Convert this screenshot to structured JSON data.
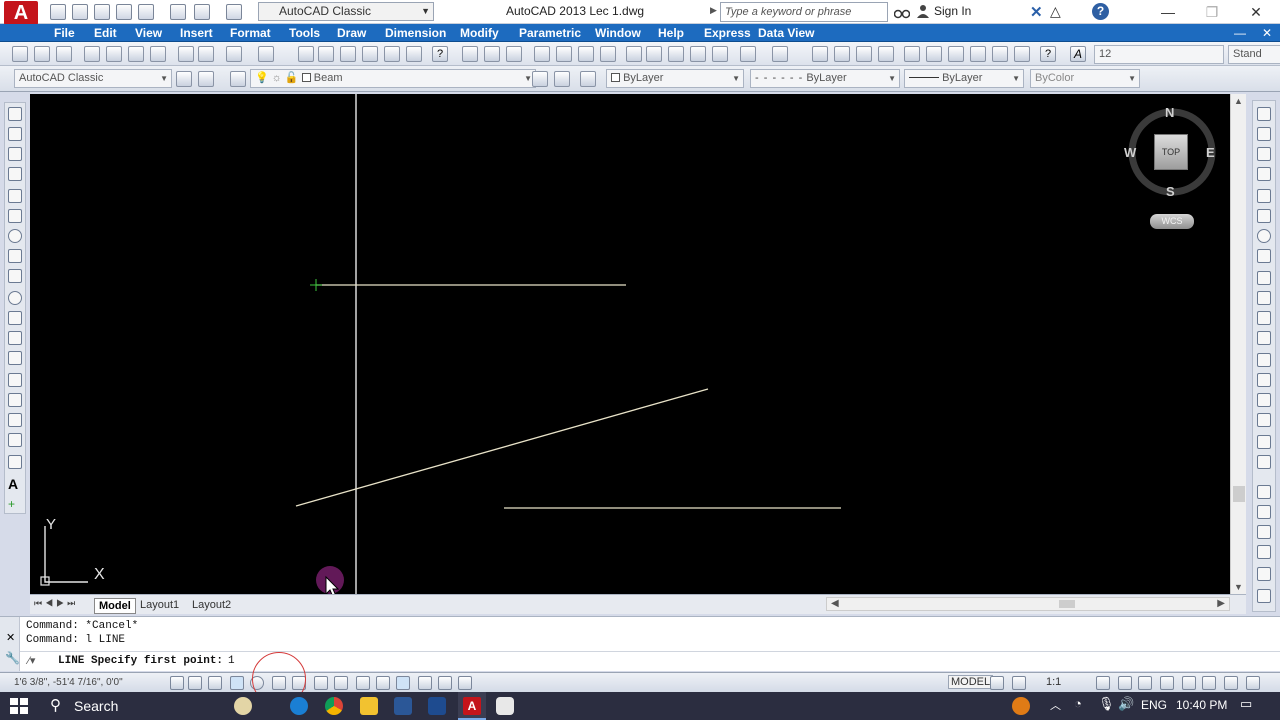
{
  "app": {
    "logo": "A",
    "workspace": "AutoCAD Classic",
    "title": "AutoCAD 2013    Lec 1.dwg",
    "search_placeholder": "Type a keyword or phrase",
    "signin": "Sign In"
  },
  "menu": [
    "File",
    "Edit",
    "View",
    "Insert",
    "Format",
    "Tools",
    "Draw",
    "Dimension",
    "Modify",
    "Parametric",
    "Window",
    "Help",
    "Express",
    "Data View"
  ],
  "toolbar2": {
    "workspace_combo": "AutoCAD Classic",
    "layer_combo": "Beam",
    "color_combo": "ByLayer",
    "linetype_combo": "ByLayer",
    "lineweight_combo": "ByLayer",
    "plotstyle_combo": "ByColor",
    "text_height": "12",
    "text_style": "Stand"
  },
  "viewcube": {
    "north": "N",
    "south": "S",
    "east": "E",
    "west": "W",
    "face": "TOP",
    "wcs": "WCS"
  },
  "ucs": {
    "x": "X",
    "y": "Y"
  },
  "tabs": [
    "Model",
    "Layout1",
    "Layout2"
  ],
  "command": {
    "history": [
      "Command: *Cancel*",
      "Command: l LINE"
    ],
    "prompt": "LINE Specify first point:",
    "input": "1"
  },
  "status": {
    "coords": "1'6 3/8\",  -51'4 7/16\", 0'0\"",
    "model": "MODEL",
    "scale": "1:1"
  },
  "taskbar": {
    "search": "Search",
    "lang": "ENG",
    "time": "10:40 PM"
  },
  "colors": {
    "menubar": "#1d6bbf",
    "canvas": "#000000",
    "line": "#e8e2c8",
    "taskbar": "#2b2d40",
    "autocad_red": "#c4141b"
  }
}
